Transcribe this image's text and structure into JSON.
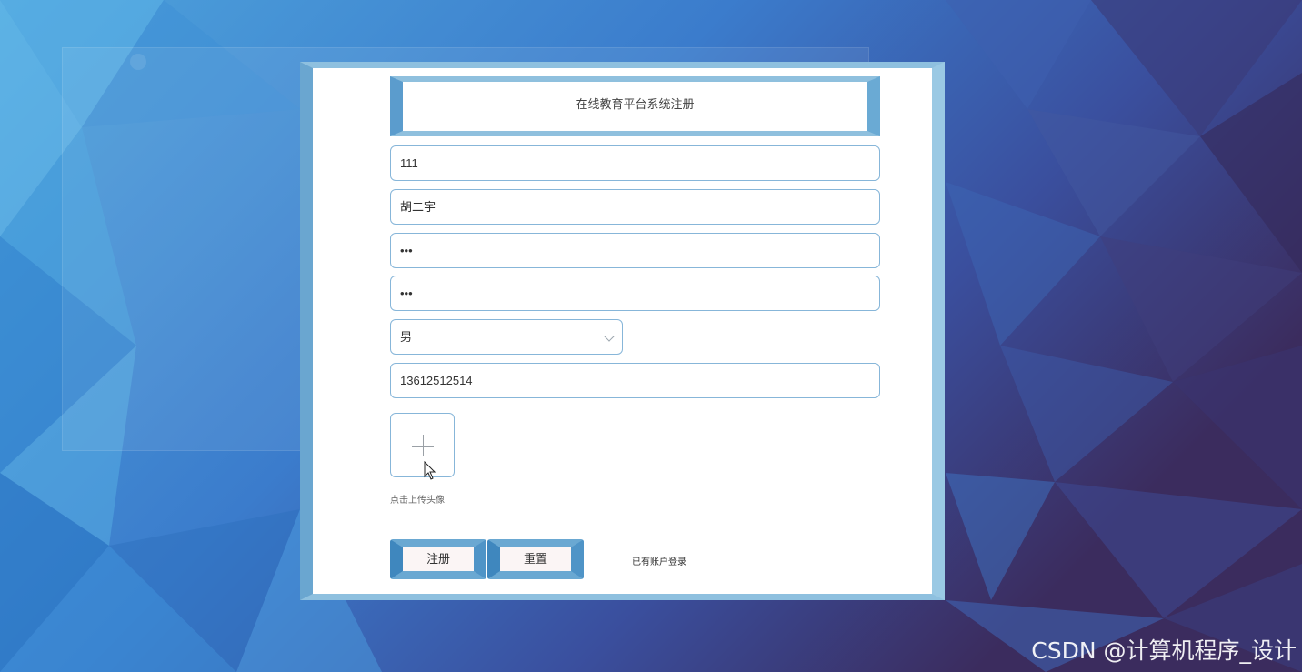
{
  "form": {
    "title": "在线教育平台系统注册",
    "account_value": "111",
    "name_value": "胡二宇",
    "password_value": "•••",
    "confirm_password_value": "•••",
    "gender_value": "男",
    "phone_value": "13612512514",
    "upload_hint": "点击上传头像",
    "register_label": "注册",
    "reset_label": "重置",
    "login_link": "已有账户登录"
  },
  "icons": {
    "upload": "plus-icon",
    "select": "chevron-down-icon",
    "pointer": "mouse-cursor-icon"
  },
  "colors": {
    "frame_blue": "#6aa6d0",
    "field_border": "#87b6d9",
    "button_fill": "#fbf5f5"
  },
  "watermark": "CSDN @计算机程序_设计"
}
